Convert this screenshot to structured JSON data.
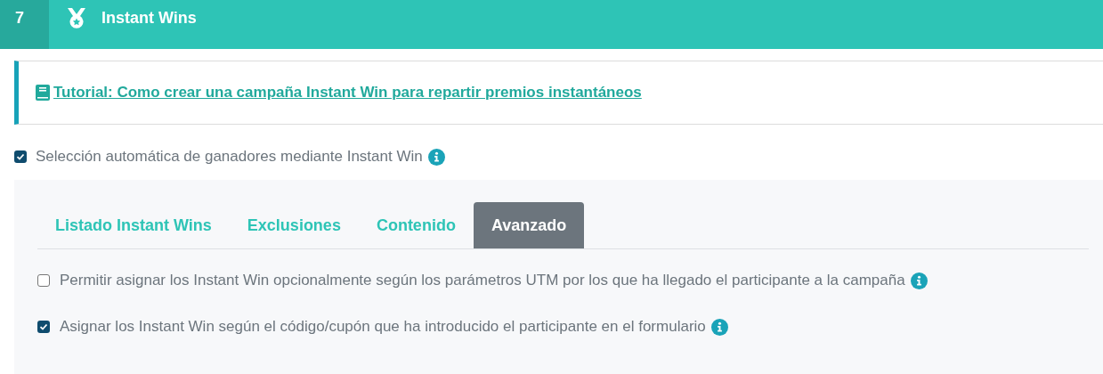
{
  "header": {
    "step": "7",
    "title": "Instant Wins"
  },
  "tutorial_link": "Tutorial: Como crear una campaña Instant Win para repartir premios instantáneos",
  "auto_select": {
    "label": "Selección automática de ganadores mediante Instant Win",
    "checked": true
  },
  "tabs": [
    {
      "label": "Listado Instant Wins",
      "selected": false
    },
    {
      "label": "Exclusiones",
      "selected": false
    },
    {
      "label": "Contenido",
      "selected": false
    },
    {
      "label": "Avanzado",
      "selected": true
    }
  ],
  "options": [
    {
      "label": "Permitir asignar los Instant Win opcionalmente según los parámetros UTM por los que ha llegado el participante a la campaña",
      "checked": false
    },
    {
      "label": "Asignar los Instant Win según el código/cupón que ha introducido el participante en el formulario",
      "checked": true
    }
  ]
}
